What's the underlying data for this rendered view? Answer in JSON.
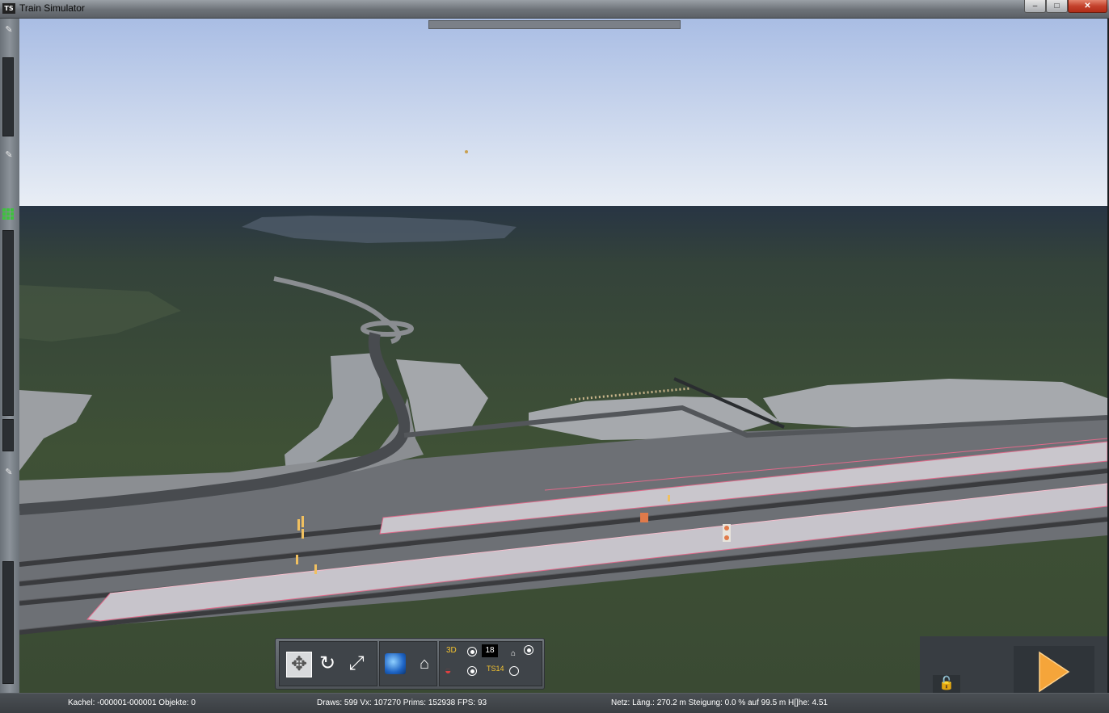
{
  "window": {
    "title": "Train Simulator",
    "icon_label": "TS",
    "minimize_glyph": "–",
    "maximize_glyph": "□",
    "close_glyph": "✕"
  },
  "left_strip": {
    "pin_glyph": "✎"
  },
  "toolbar": {
    "speed_value": "18",
    "icons": [
      "move-icon",
      "rotate-icon",
      "scale-icon",
      "globe-icon",
      "home-icon",
      "3d-grid-icon",
      "camera-icon",
      "mouse-icon",
      "ts14-icon"
    ],
    "label_3d": "3D",
    "label_ts14": "TS14"
  },
  "bottom_right": {
    "lock_glyph": "🔓"
  },
  "status_bar": {
    "tile_info": "Kachel: -000001-000001  Objekte: 0",
    "perf_info": "Draws: 599 Vx: 107270 Prims: 152938 FPS: 93",
    "net_info": "Netz:  Läng.:  270.2 m Steigung:  0.0 % auf 99.5 m H[]he:   4.51"
  },
  "colors": {
    "sky_top": "#a9bde4",
    "sky_horizon": "#e9eef5",
    "ground": "#3e4e37",
    "platform": "#c9c6cc",
    "accent_play": "#f5a53a"
  }
}
